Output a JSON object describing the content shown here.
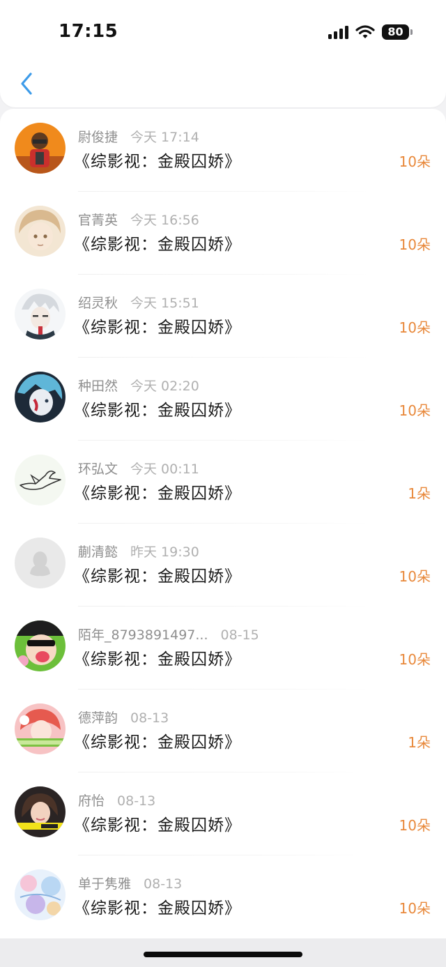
{
  "status_bar": {
    "time": "17:15",
    "battery": "80"
  },
  "nav": {
    "back_icon": "chevron-left-icon"
  },
  "colors": {
    "accent": "#3d9be9",
    "flower_count": "#e8883a"
  },
  "list": [
    {
      "name": "尉俊捷",
      "time": "今天 17:14",
      "title": "《综影视：金殿囚娇》",
      "flowers": "10朵"
    },
    {
      "name": "官菁英",
      "time": "今天 16:56",
      "title": "《综影视：金殿囚娇》",
      "flowers": "10朵"
    },
    {
      "name": "绍灵秋",
      "time": "今天 15:51",
      "title": "《综影视：金殿囚娇》",
      "flowers": "10朵"
    },
    {
      "name": "种田然",
      "time": "今天 02:20",
      "title": "《综影视：金殿囚娇》",
      "flowers": "10朵"
    },
    {
      "name": "环弘文",
      "time": "今天 00:11",
      "title": "《综影视：金殿囚娇》",
      "flowers": "1朵"
    },
    {
      "name": "蒯清懿",
      "time": "昨天 19:30",
      "title": "《综影视：金殿囚娇》",
      "flowers": "10朵"
    },
    {
      "name": "陌年_8793891497...",
      "time": "08-15",
      "title": "《综影视：金殿囚娇》",
      "flowers": "10朵"
    },
    {
      "name": "德萍韵",
      "time": "08-13",
      "title": "《综影视：金殿囚娇》",
      "flowers": "1朵"
    },
    {
      "name": "府怡",
      "time": "08-13",
      "title": "《综影视：金殿囚娇》",
      "flowers": "10朵"
    },
    {
      "name": "单于隽雅",
      "time": "08-13",
      "title": "《综影视：金殿囚娇》",
      "flowers": "10朵"
    }
  ]
}
